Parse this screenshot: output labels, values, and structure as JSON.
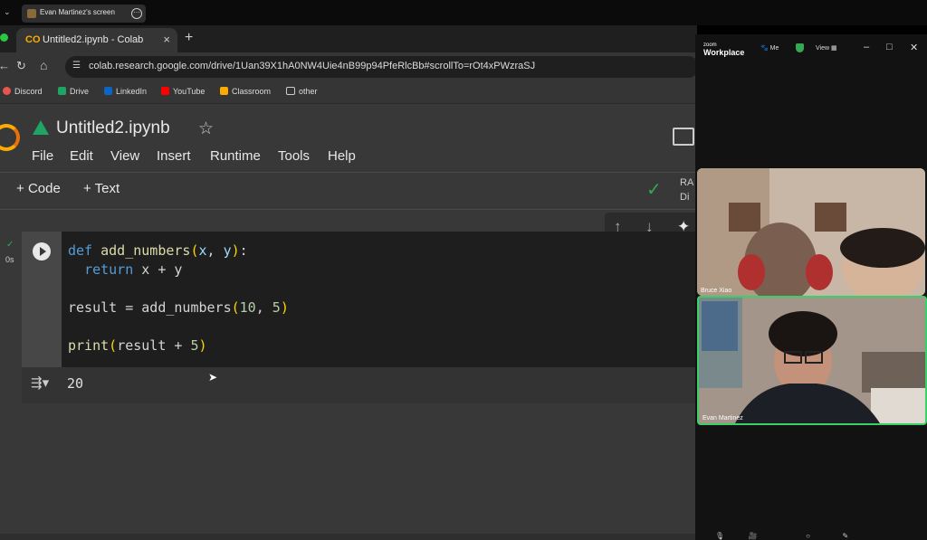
{
  "share_bar": {
    "title": "Evan Martinez's screen"
  },
  "browser": {
    "tab_title": "Untitled2.ipynb - Colab",
    "url": "colab.research.google.com/drive/1Uan39X1hA0NW4Uie4nB99p94PfeRlcBb#scrollTo=rOt4xPWzraSJ",
    "bookmarks": [
      "Discord",
      "Drive",
      "LinkedIn",
      "YouTube",
      "Classroom",
      "other"
    ]
  },
  "colab": {
    "notebook_title": "Untitled2.ipynb",
    "menu": [
      "File",
      "Edit",
      "View",
      "Insert",
      "Runtime",
      "Tools",
      "Help"
    ],
    "add_code_label": "Code",
    "add_text_label": "Text",
    "ram_label_1": "RA",
    "ram_label_2": "Di",
    "cell": {
      "exec_time": "0s",
      "code": {
        "l1_def": "def",
        "l1_fn": "add_numbers",
        "l1_x": "x",
        "l1_y": "y",
        "l2_return": "return",
        "l2_x": "x",
        "l2_y": "y",
        "l4_result": "result",
        "l4_fn": "add_numbers",
        "l4_a": "10",
        "l4_b": "5",
        "l6_print": "print",
        "l6_result": "result",
        "l6_num": "5"
      },
      "output": "20"
    }
  },
  "zoom": {
    "logo_top": "zoom",
    "logo_bottom": "Workplace",
    "me_label": "Me",
    "view_label": "View",
    "participants": [
      "Bruce Xiao",
      "Evan Martinez"
    ]
  }
}
